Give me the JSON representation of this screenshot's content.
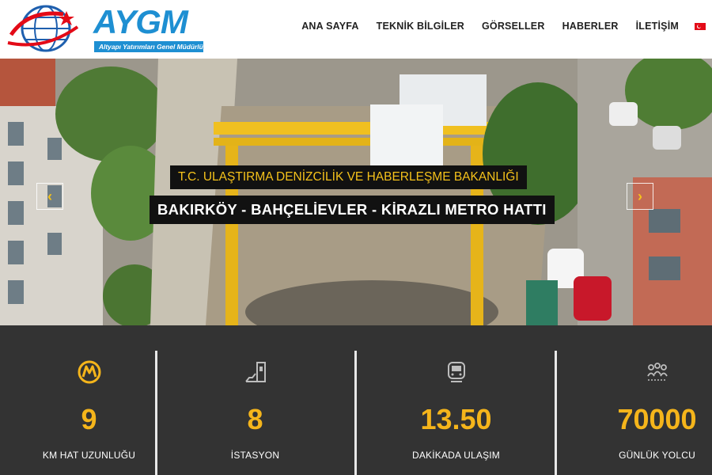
{
  "logo": {
    "text": "AYGM",
    "subtitle": "Altyapı Yatırımları Genel Müdürlüğü"
  },
  "nav": {
    "items": [
      "ANA SAYFA",
      "TEKNİK BİLGİLER",
      "GÖRSELLER",
      "HABERLER",
      "İLETİŞİM"
    ],
    "language": "tr-flag-icon"
  },
  "hero": {
    "caption_top": "T.C. ULAŞTIRMA DENİZCİLİK VE HABERLEŞME BAKANLIĞI",
    "caption_main": "BAKIRKÖY - BAHÇELİEVLER - KİRAZLI METRO HATTI",
    "prev_icon": "chevron-left-icon",
    "next_icon": "chevron-right-icon"
  },
  "stats": [
    {
      "icon": "metro-logo-icon",
      "value": "9",
      "label": "KM HAT UZUNLUĞU"
    },
    {
      "icon": "station-icon",
      "value": "8",
      "label": "İSTASYON"
    },
    {
      "icon": "train-icon",
      "value": "13.50",
      "label": "DAKİKADA ULAŞIM"
    },
    {
      "icon": "passengers-icon",
      "value": "70000",
      "label": "GÜNLÜK YOLCU"
    }
  ],
  "colors": {
    "accent": "#f5b51b",
    "brand_blue": "#1e8fd2",
    "stats_bg": "#333333"
  }
}
